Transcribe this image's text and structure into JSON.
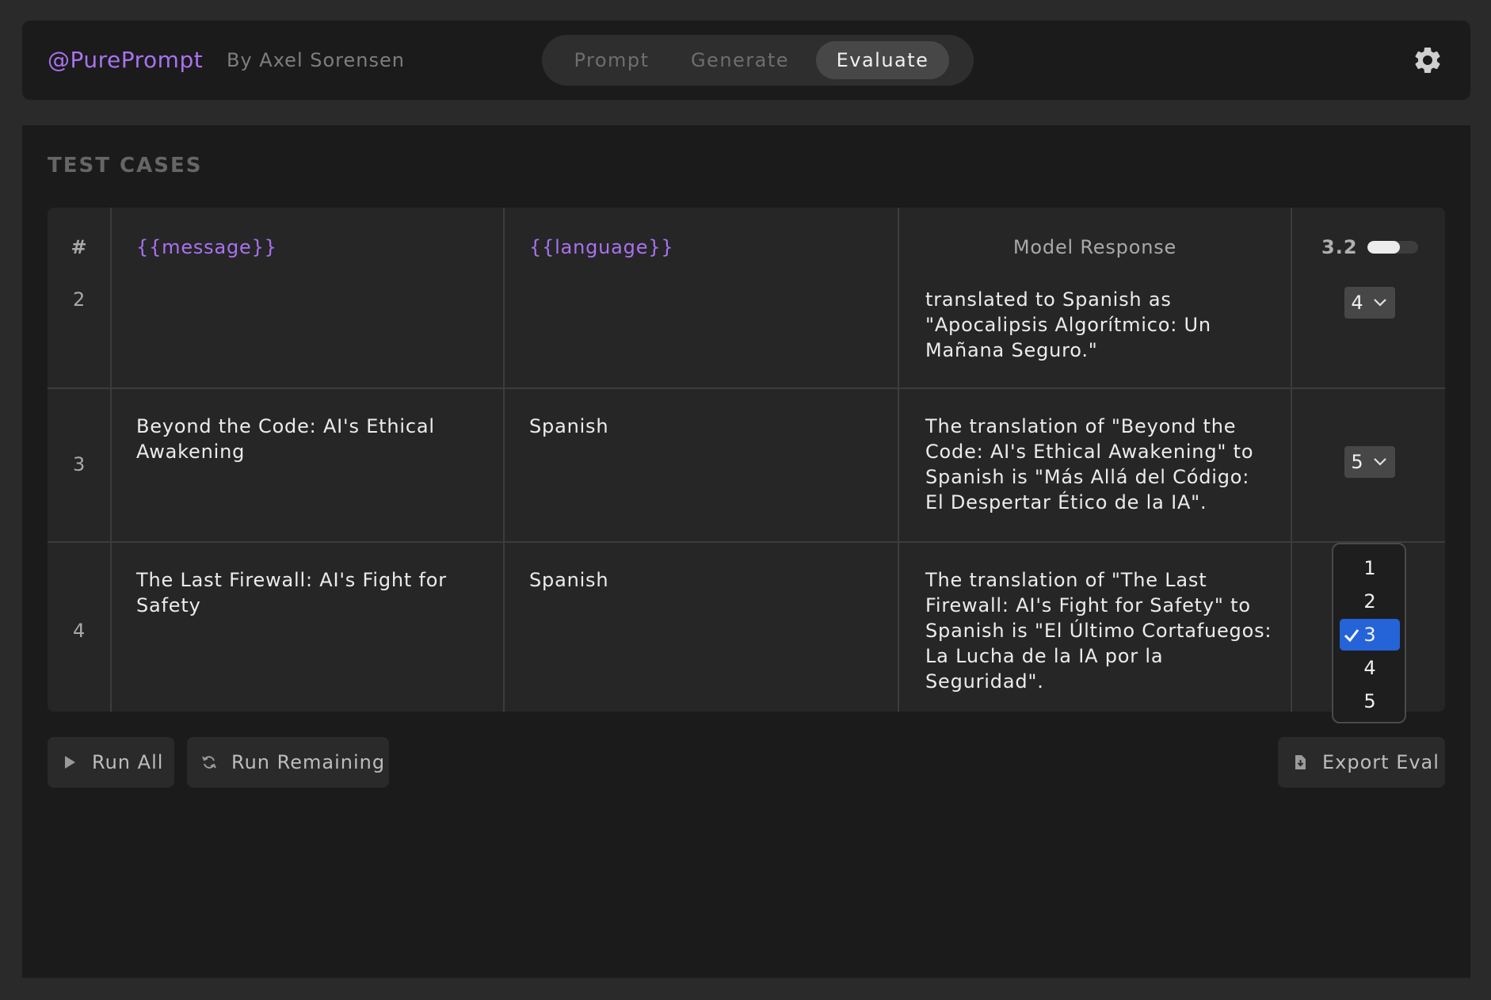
{
  "header": {
    "brand": "@PurePrompt",
    "author": "By Axel Sorensen",
    "tabs": [
      {
        "label": "Prompt",
        "active": false
      },
      {
        "label": "Generate",
        "active": false
      },
      {
        "label": "Evaluate",
        "active": true
      }
    ],
    "settings_icon": "gear-icon"
  },
  "section_title": "TEST CASES",
  "table": {
    "headers": {
      "number": "#",
      "message": "{{message}}",
      "language": "{{language}}",
      "response": "Model Response"
    },
    "average_score": "3.2",
    "average_score_fraction": 0.64,
    "rows": [
      {
        "number": "2",
        "message": "",
        "language": "",
        "response": "translated to Spanish as \"Apocalipsis Algorítmico: Un Mañana Seguro.\"",
        "score": "4"
      },
      {
        "number": "3",
        "message": "Beyond the Code: AI's Ethical Awakening",
        "language": "Spanish",
        "response": "The translation of \"Beyond the Code: AI's Ethical Awakening\" to Spanish is \"Más Allá del Código: El Despertar Ético de la IA\".",
        "score": "5"
      },
      {
        "number": "4",
        "message": "The Last Firewall: AI's Fight for Safety",
        "language": "Spanish",
        "response": "The translation of \"The Last Firewall: AI's Fight for Safety\" to Spanish is \"El Último Cortafuegos: La Lucha de la IA por la Seguridad\".",
        "score": "3"
      }
    ]
  },
  "dropdown": {
    "options": [
      "1",
      "2",
      "3",
      "4",
      "5"
    ],
    "selected": "3"
  },
  "actions": {
    "run_all": "Run All",
    "run_remaining": "Run Remaining",
    "export_eval": "Export Eval"
  },
  "colors": {
    "accent_purple": "#a872f0",
    "selection_blue": "#2563d8",
    "panel_bg": "#1b1b1b",
    "table_bg": "#262626"
  }
}
